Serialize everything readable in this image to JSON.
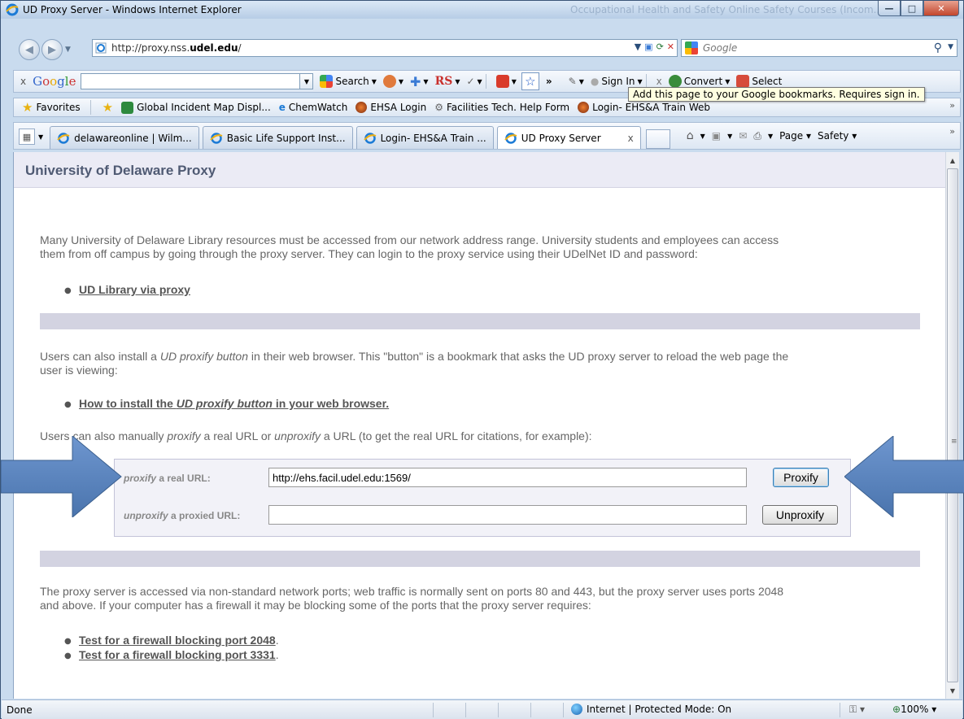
{
  "window": {
    "title": "UD Proxy Server - Windows Internet Explorer",
    "background_title": "Occupational Health and Safety Online Safety Courses (Incom..."
  },
  "address": {
    "url_prefix": "http://proxy.nss.",
    "url_domain": "udel.edu",
    "url_suffix": "/"
  },
  "search": {
    "placeholder": "Google"
  },
  "google_toolbar": {
    "close": "x",
    "search_label": "Search",
    "rs_label": "RS",
    "sign_in_label": "Sign In",
    "convert_label": "Convert",
    "select_label": "Select",
    "tooltip": "Add this page to your Google bookmarks. Requires sign in."
  },
  "favorites_bar": {
    "favorites_label": "Favorites",
    "items": [
      {
        "label": "Global Incident Map Displ..."
      },
      {
        "label": "ChemWatch"
      },
      {
        "label": "EHSA Login"
      },
      {
        "label": "Facilities Tech. Help Form"
      },
      {
        "label": "Login- EHS&A Train Web"
      }
    ]
  },
  "tabs": [
    {
      "label": "delawareonline | Wilm..."
    },
    {
      "label": "Basic Life Support Inst..."
    },
    {
      "label": "Login- EHS&A Train ..."
    },
    {
      "label": "UD Proxy Server",
      "close": "x"
    }
  ],
  "command_bar": {
    "page_label": "Page",
    "safety_label": "Safety"
  },
  "page": {
    "title": "University of Delaware Proxy",
    "intro_line1": "Many University of Delaware Library resources must be accessed from our network address range. University students and employees can access",
    "intro_line2": "them from off campus by going through the proxy server. They can login to the proxy service using their UDelNet ID and password:",
    "library_link": "UD Library via proxy",
    "button_line1_a": "Users can also install a ",
    "button_line1_em": "UD proxify button",
    "button_line1_b": " in their web browser. This \"button\" is a bookmark that asks the UD proxy server to reload the web page the",
    "button_line2": "user is viewing:",
    "install_link_a": "How to install the ",
    "install_link_em": "UD proxify button",
    "install_link_b": " in your web browser.",
    "manual_a": "Users can also manually ",
    "manual_em1": "proxify",
    "manual_b": " a real URL or ",
    "manual_em2": "unproxify",
    "manual_c": " a URL (to get the real URL for citations, for example):",
    "form": {
      "proxify_em": "proxify",
      "proxify_label": " a real URL:",
      "proxify_value": "http://ehs.facil.udel.edu:1569/",
      "proxify_button": "Proxify",
      "unproxify_em": "unproxify",
      "unproxify_label": " a proxied URL:",
      "unproxify_value": "",
      "unproxify_button": "Unproxify"
    },
    "ports_line1": "The proxy server is accessed via non-standard network ports; web traffic is normally sent on ports 80 and 443, but the proxy server uses ports 2048",
    "ports_line2": "and above. If your computer has a firewall it may be blocking some of the ports that the proxy server requires:",
    "test_links": [
      {
        "label": "Test for a firewall blocking port 2048",
        "suffix": "."
      },
      {
        "label": "Test for a firewall blocking port 3331",
        "suffix": "."
      }
    ]
  },
  "status": {
    "left": "Done",
    "zone": "Internet | Protected Mode: On",
    "zoom": "100%"
  },
  "colors": {
    "arrow": "#4f81bd",
    "header_bg": "#ebebf5",
    "divider": "#d3d3e1"
  },
  "icons": [
    "ie-logo-icon",
    "back-icon",
    "forward-icon",
    "refresh-icon",
    "stop-icon",
    "search-icon",
    "star-icon",
    "home-icon",
    "feed-icon",
    "print-icon",
    "globe-icon",
    "zoom-icon"
  ]
}
